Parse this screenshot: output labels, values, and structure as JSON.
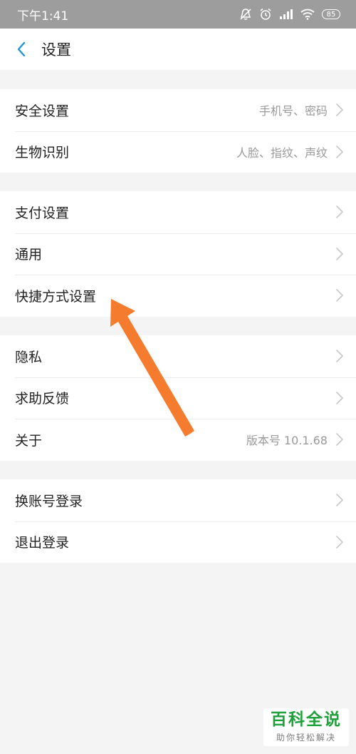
{
  "status_bar": {
    "time": "下午1:41",
    "battery": "85",
    "icons": [
      "silent-icon",
      "alarm-icon",
      "signal-icon",
      "wifi-icon",
      "battery-icon"
    ]
  },
  "header": {
    "title": "设置",
    "back_icon": "chevron-left-icon"
  },
  "groups": [
    {
      "items": [
        {
          "label": "安全设置",
          "value": "手机号、密码"
        },
        {
          "label": "生物识别",
          "value": "人脸、指纹、声纹"
        }
      ]
    },
    {
      "items": [
        {
          "label": "支付设置",
          "value": ""
        },
        {
          "label": "通用",
          "value": ""
        },
        {
          "label": "快捷方式设置",
          "value": ""
        }
      ]
    },
    {
      "items": [
        {
          "label": "隐私",
          "value": ""
        },
        {
          "label": "求助反馈",
          "value": ""
        },
        {
          "label": "关于",
          "value": "版本号 10.1.68"
        }
      ]
    },
    {
      "items": [
        {
          "label": "换账号登录",
          "value": ""
        },
        {
          "label": "退出登录",
          "value": ""
        }
      ]
    }
  ],
  "watermark": {
    "title": "百科全说",
    "subtitle": "助你轻松解决"
  },
  "colors": {
    "accent": "#2196d6",
    "arrow": "#f57c2e",
    "watermark": "#1fa03a"
  }
}
